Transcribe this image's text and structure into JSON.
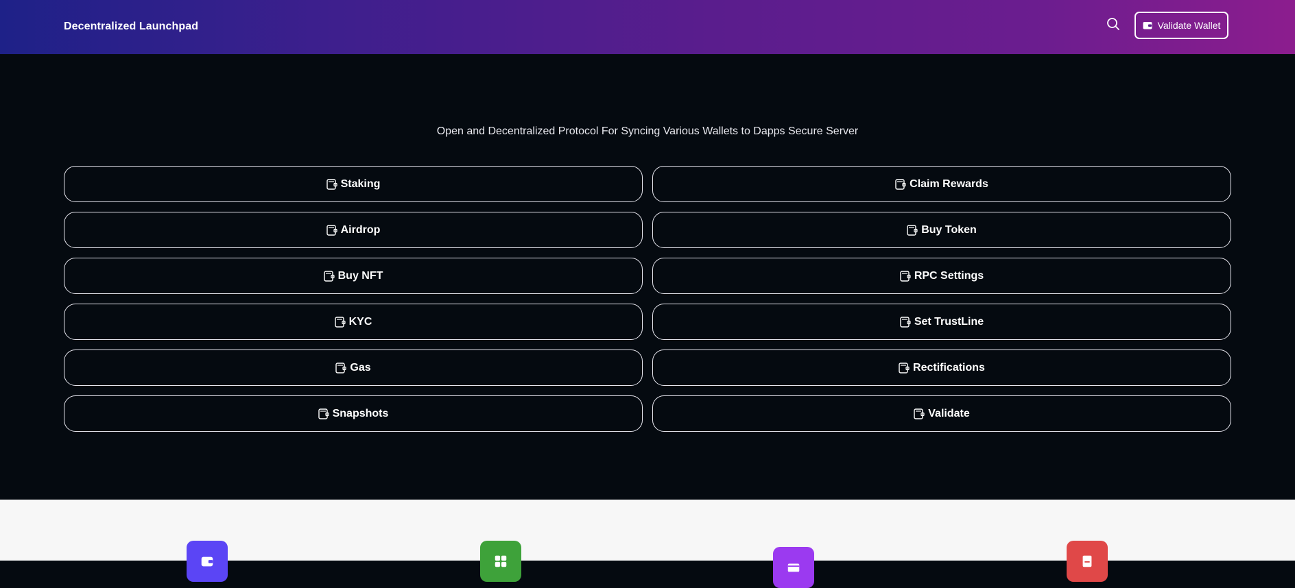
{
  "header": {
    "brand": "Decentralized Launchpad",
    "search_icon": "search-icon",
    "validate_label": "Validate Wallet",
    "gradient_colors": [
      "#1e2188",
      "#8c1d8e"
    ]
  },
  "hero": {
    "subtitle": "Open and Decentralized Protocol For Syncing Various Wallets to Dapps Secure Server"
  },
  "actions": [
    {
      "label": "Staking",
      "icon": "wallet-icon"
    },
    {
      "label": "Claim Rewards",
      "icon": "wallet-icon"
    },
    {
      "label": "Airdrop",
      "icon": "wallet-icon"
    },
    {
      "label": "Buy Token",
      "icon": "wallet-icon"
    },
    {
      "label": "Buy NFT",
      "icon": "wallet-icon"
    },
    {
      "label": "RPC Settings",
      "icon": "wallet-icon"
    },
    {
      "label": "KYC",
      "icon": "wallet-icon"
    },
    {
      "label": "Set TrustLine",
      "icon": "wallet-icon"
    },
    {
      "label": "Gas",
      "icon": "wallet-icon"
    },
    {
      "label": "Rectifications",
      "icon": "wallet-icon"
    },
    {
      "label": "Snapshots",
      "icon": "wallet-icon"
    },
    {
      "label": "Validate",
      "icon": "wallet-icon"
    }
  ],
  "features": [
    {
      "icon": "wallet-icon",
      "color": "#5b45f5"
    },
    {
      "icon": "grid-icon",
      "color": "#3ea23a"
    },
    {
      "icon": "card-icon",
      "color": "#9b3af0"
    },
    {
      "icon": "document-icon",
      "color": "#e04848"
    }
  ],
  "colors": {
    "background": "#050a10",
    "lower_section": "#f7f7f7",
    "border": "#e6e6ee"
  }
}
